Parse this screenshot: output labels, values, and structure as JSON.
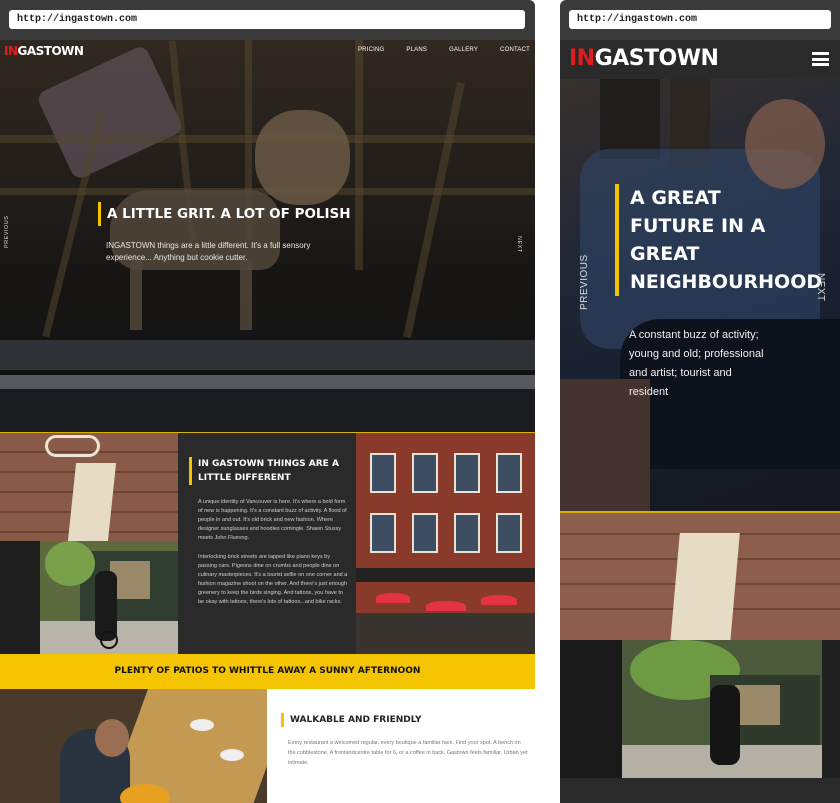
{
  "desktop": {
    "url": "http://ingastown.com",
    "logo": {
      "prefix": "IN",
      "suffix": "GASTOWN"
    },
    "nav": [
      "PRICING",
      "PLANS",
      "GALLERY",
      "CONTACT"
    ],
    "hero": {
      "previous": "PREVIOUS",
      "next": "NEXT",
      "title": "A LITTLE GRIT. A LOT OF POLISH",
      "text": "INGASTOWN things are a little different. It's a full sensory experience... Anything but cookie cutter."
    },
    "feature": {
      "title": "IN GASTOWN THINGS ARE A LITTLE DIFFERENT",
      "paragraph1": "A unique identity of Vancouver is here. It's where a bold form of new is happening. It's a constant buzz of activity. A flood of people in and out. It's old brick and new fashion. Where designer sunglasses and hoodies comingle. Shawn Stussy meets John Fluevog.",
      "paragraph2": "Interlocking brick streets are tapped like piano keys by passing cars. Pigeons dine on crumbs and people dine on culinary masterpieces. It's a tourist selfie on one corner and a fashion magazine shoot on the other. And there's just enough greenery to keep the birds singing. And tattoos, you have to be okay with tattoos, there's lots of tattoos...and bike racks."
    },
    "banner": "PLENTY OF PATIOS TO WHITTLE AWAY A SUNNY AFTERNOON",
    "walkable": {
      "title": "WALKABLE AND FRIENDLY",
      "text": "Every restaurant a welcomed regular, every boutique a familiar face. Find your spot. A bench on the cobblestone. A frontandcentre table for 6, or a coffee in back. Gastown feels familiar. Urban yet intimate."
    }
  },
  "mobile": {
    "url": "http://ingastown.com",
    "logo": {
      "prefix": "IN",
      "suffix": "GASTOWN"
    },
    "hero": {
      "previous": "PREVIOUS",
      "next": "NEXT",
      "title": "A GREAT FUTURE IN A GREAT NEIGHBOURHOOD",
      "text": "A constant buzz of activity; young and old; professional and artist; tourist and resident"
    }
  },
  "colors": {
    "accent": "#f5c400",
    "logo_red": "#e11c1c",
    "dark": "#2a2a2a"
  },
  "icons": {
    "menu": "hamburger-icon"
  }
}
